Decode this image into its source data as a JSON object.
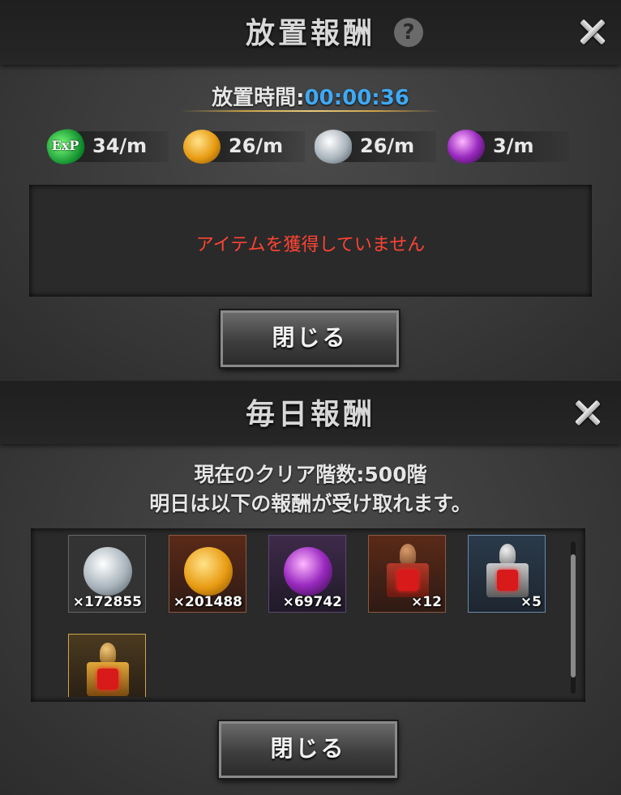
{
  "idle_panel": {
    "title": "放置報酬",
    "help_icon": "question-icon",
    "close_icon": "close-icon",
    "idle_time_label": "放置時間:",
    "idle_time_value": "00:00:36",
    "rates": [
      {
        "icon": "exp-icon",
        "icon_text": "ExP",
        "value": "34/m"
      },
      {
        "icon": "gold-coin-icon",
        "value": "26/m"
      },
      {
        "icon": "silver-coin-icon",
        "value": "26/m"
      },
      {
        "icon": "purple-orb-icon",
        "value": "3/m"
      }
    ],
    "empty_message": "アイテムを獲得していません",
    "close_button": "閉じる"
  },
  "daily_panel": {
    "title": "毎日報酬",
    "close_icon": "close-icon",
    "clear_floors_line": "現在のクリア階数:500階",
    "tomorrow_line": "明日は以下の報酬が受け取れます。",
    "items": [
      {
        "icon": "silver-coin-icon",
        "count": "×172855"
      },
      {
        "icon": "gold-coin-icon",
        "count": "×201488"
      },
      {
        "icon": "purple-orb-icon",
        "count": "×69742"
      },
      {
        "icon": "red-stamp-icon",
        "count": "×12"
      },
      {
        "icon": "silver-stamp-icon",
        "count": "×5"
      },
      {
        "icon": "gold-stamp-icon",
        "count": ""
      }
    ],
    "close_button": "閉じる"
  },
  "colors": {
    "time_value": "#3fa9f5",
    "empty_message": "#ff4433"
  }
}
